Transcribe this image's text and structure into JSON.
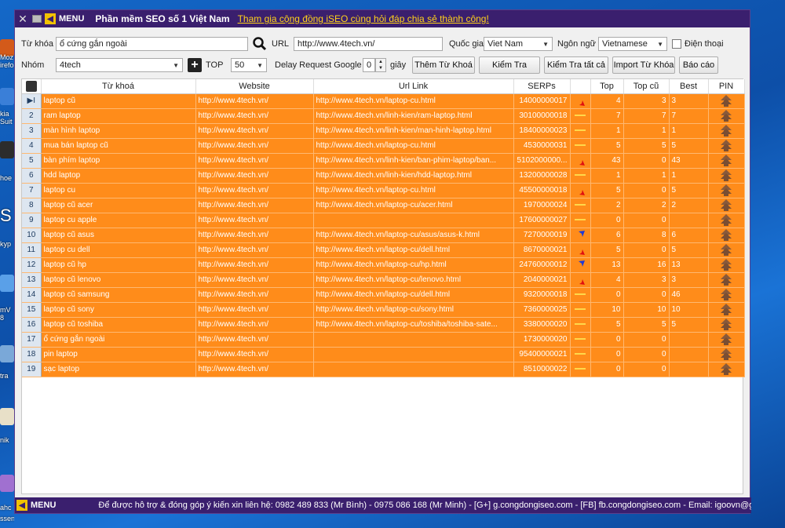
{
  "window": {
    "menu_label": "MENU",
    "title": "Phần mềm SEO số 1 Việt Nam",
    "community_link": "Tham gia cộng đồng iSEO cùng hỏi đáp  chia sẻ thành công!"
  },
  "controls": {
    "keyword_label": "Từ khóa",
    "keyword_value": "ổ cứng gắn ngoài",
    "url_label": "URL",
    "url_value": "http://www.4tech.vn/",
    "country_label": "Quốc gia",
    "country_value": "Viet Nam",
    "language_label": "Ngôn ngữ",
    "language_value": "Vietnamese",
    "phone_label": "Điện thoại",
    "group_label": "Nhóm",
    "group_value": "4tech",
    "top_label": "TOP",
    "top_value": "50",
    "delay_label": "Delay Request Google",
    "delay_value": "0",
    "seconds_label": "giây",
    "add_keyword_button": "Thêm Từ Khoá",
    "check_button": "Kiểm Tra",
    "check_all_button": "Kiểm Tra tất cả",
    "import_button": "Import Từ Khóa",
    "report_button": "Báo cáo"
  },
  "table": {
    "headers": [
      "Từ khoá",
      "Website",
      "Url Link",
      "SERPs",
      "",
      "Top",
      "Top cũ",
      "Best",
      "PIN"
    ],
    "rows": [
      {
        "n": "1",
        "kw": "laptop cũ",
        "site": "http://www.4tech.vn/",
        "url": "http://www.4tech.vn/laptop-cu.html",
        "serps": "14000000017",
        "trend": "down",
        "top": "4",
        "old": "3",
        "best": "3",
        "current": true
      },
      {
        "n": "2",
        "kw": "ram laptop",
        "site": "http://www.4tech.vn/",
        "url": "http://www.4tech.vn/linh-kien/ram-laptop.html",
        "serps": "30100000018",
        "trend": "same",
        "top": "7",
        "old": "7",
        "best": "7"
      },
      {
        "n": "3",
        "kw": "màn hình laptop",
        "site": "http://www.4tech.vn/",
        "url": "http://www.4tech.vn/linh-kien/man-hinh-laptop.html",
        "serps": "18400000023",
        "trend": "same",
        "top": "1",
        "old": "1",
        "best": "1"
      },
      {
        "n": "4",
        "kw": "mua bán laptop cũ",
        "site": "http://www.4tech.vn/",
        "url": "http://www.4tech.vn/laptop-cu.html",
        "serps": "4530000031",
        "trend": "same",
        "top": "5",
        "old": "5",
        "best": "5"
      },
      {
        "n": "5",
        "kw": "bàn phím laptop",
        "site": "http://www.4tech.vn/",
        "url": "http://www.4tech.vn/linh-kien/ban-phim-laptop/ban...",
        "serps": "5102000000...",
        "trend": "down",
        "top": "43",
        "old": "0",
        "best": "43"
      },
      {
        "n": "6",
        "kw": "hdd laptop",
        "site": "http://www.4tech.vn/",
        "url": "http://www.4tech.vn/linh-kien/hdd-laptop.html",
        "serps": "13200000028",
        "trend": "same",
        "top": "1",
        "old": "1",
        "best": "1"
      },
      {
        "n": "7",
        "kw": "laptop cu",
        "site": "http://www.4tech.vn/",
        "url": "http://www.4tech.vn/laptop-cu.html",
        "serps": "45500000018",
        "trend": "down",
        "top": "5",
        "old": "0",
        "best": "5"
      },
      {
        "n": "8",
        "kw": "laptop cũ acer",
        "site": "http://www.4tech.vn/",
        "url": "http://www.4tech.vn/laptop-cu/acer.html",
        "serps": "1970000024",
        "trend": "same",
        "top": "2",
        "old": "2",
        "best": "2"
      },
      {
        "n": "9",
        "kw": "laptop cu apple",
        "site": "http://www.4tech.vn/",
        "url": "",
        "serps": "17600000027",
        "trend": "same",
        "top": "0",
        "old": "0",
        "best": ""
      },
      {
        "n": "10",
        "kw": "laptop cũ asus",
        "site": "http://www.4tech.vn/",
        "url": "http://www.4tech.vn/laptop-cu/asus/asus-k.html",
        "serps": "7270000019",
        "trend": "up",
        "top": "6",
        "old": "8",
        "best": "6"
      },
      {
        "n": "11",
        "kw": "laptop cu dell",
        "site": "http://www.4tech.vn/",
        "url": "http://www.4tech.vn/laptop-cu/dell.html",
        "serps": "8670000021",
        "trend": "down",
        "top": "5",
        "old": "0",
        "best": "5"
      },
      {
        "n": "12",
        "kw": "laptop cũ hp",
        "site": "http://www.4tech.vn/",
        "url": "http://www.4tech.vn/laptop-cu/hp.html",
        "serps": "24760000012",
        "trend": "up",
        "top": "13",
        "old": "16",
        "best": "13"
      },
      {
        "n": "13",
        "kw": "laptop cũ lenovo",
        "site": "http://www.4tech.vn/",
        "url": "http://www.4tech.vn/laptop-cu/lenovo.html",
        "serps": "2040000021",
        "trend": "down",
        "top": "4",
        "old": "3",
        "best": "3"
      },
      {
        "n": "14",
        "kw": "laptop cũ samsung",
        "site": "http://www.4tech.vn/",
        "url": "http://www.4tech.vn/laptop-cu/dell.html",
        "serps": "9320000018",
        "trend": "same",
        "top": "0",
        "old": "0",
        "best": "46"
      },
      {
        "n": "15",
        "kw": "laptop cũ sony",
        "site": "http://www.4tech.vn/",
        "url": "http://www.4tech.vn/laptop-cu/sony.html",
        "serps": "7360000025",
        "trend": "same",
        "top": "10",
        "old": "10",
        "best": "10"
      },
      {
        "n": "16",
        "kw": "laptop cũ toshiba",
        "site": "http://www.4tech.vn/",
        "url": "http://www.4tech.vn/laptop-cu/toshiba/toshiba-sate...",
        "serps": "3380000020",
        "trend": "same",
        "top": "5",
        "old": "5",
        "best": "5"
      },
      {
        "n": "17",
        "kw": "ổ cứng gắn ngoài",
        "site": "http://www.4tech.vn/",
        "url": "",
        "serps": "1730000020",
        "trend": "same",
        "top": "0",
        "old": "0",
        "best": ""
      },
      {
        "n": "18",
        "kw": "pin laptop",
        "site": "http://www.4tech.vn/",
        "url": "",
        "serps": "95400000021",
        "trend": "same",
        "top": "0",
        "old": "0",
        "best": ""
      },
      {
        "n": "19",
        "kw": "sạc laptop",
        "site": "http://www.4tech.vn/",
        "url": "",
        "serps": "8510000022",
        "trend": "same",
        "top": "0",
        "old": "0",
        "best": ""
      }
    ]
  },
  "status": {
    "menu_label": "MENU",
    "text": "Để được hỗ trợ & đóng góp ý kiến xin liên hệ: 0982 489 833 (Mr Bình) - 0975 086 168 (Mr Minh) - [G+] g.congdongiseo.com - [FB] fb.congdongiseo.com - Email: igoovn@gmail.com"
  },
  "desktop": {
    "labels": [
      "Moz",
      "irefo",
      "kia",
      "Suit",
      "hoe",
      "S",
      "kyp",
      "mV",
      "8",
      "tra",
      "nik",
      "ahc",
      "ssenger"
    ]
  },
  "colors": {
    "titlebar": "#3a1f6e",
    "row_bg": "#ff8c1a",
    "accent_link": "#ffd21a",
    "trend_down": "#e01010",
    "trend_up": "#1f3ad6",
    "trend_same": "#ffd84a"
  }
}
